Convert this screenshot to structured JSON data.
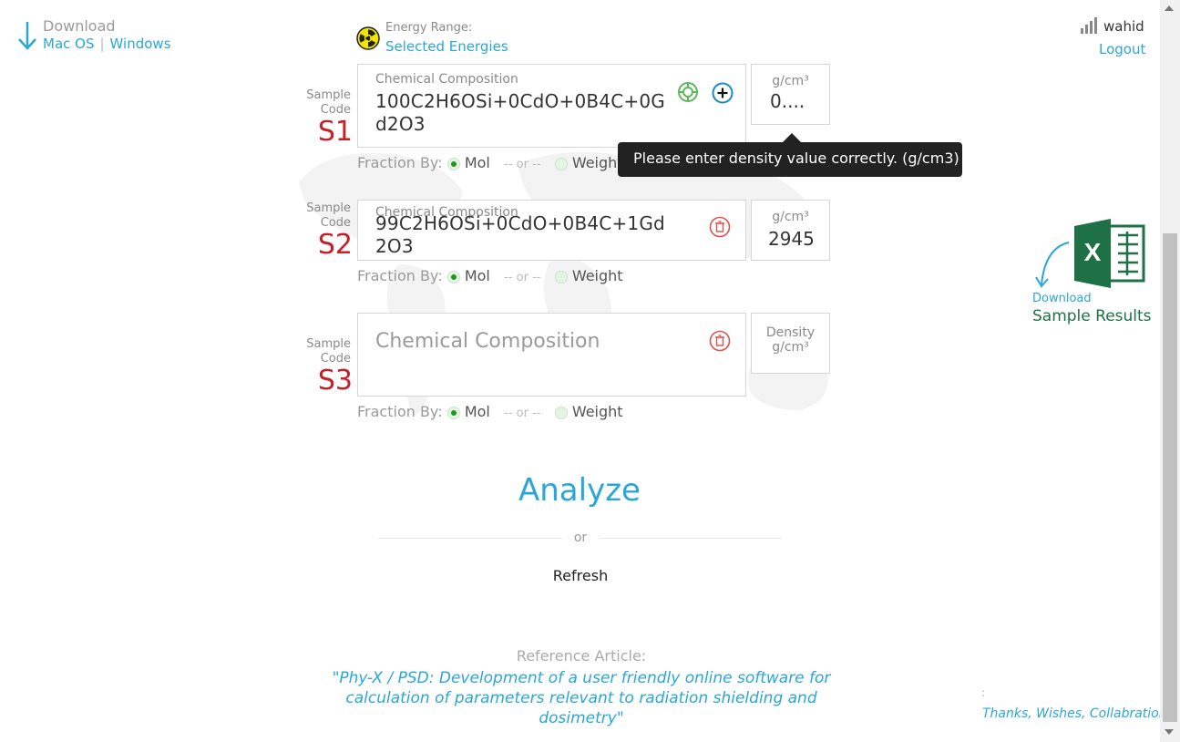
{
  "download": {
    "title": "Download",
    "mac_label": "Mac OS",
    "separator": "|",
    "windows_label": "Windows"
  },
  "energy": {
    "label": "Energy Range:",
    "value": "Selected Energies",
    "icon": "radiation-icon"
  },
  "user": {
    "name": "wahid",
    "logout": "Logout"
  },
  "samples": [
    {
      "label_line1": "Sample",
      "label_line2": "Code",
      "code": "S1",
      "comp_label": "Chemical Composition",
      "comp_value": "100C2H6OSi+0CdO+0B4C+0Gd2O3",
      "density_unit": "g/cm³",
      "density_value": "0....",
      "fraction_label": "Fraction By:",
      "mol": "Mol",
      "or": "-- or --",
      "weight": "Weight",
      "selected": "Mol"
    },
    {
      "label_line1": "Sample",
      "label_line2": "Code",
      "code": "S2",
      "comp_label": "Chemical Composition",
      "comp_value": "99C2H6OSi+0CdO+0B4C+1Gd2O3",
      "density_unit": "g/cm³",
      "density_value": "2945",
      "fraction_label": "Fraction By:",
      "mol": "Mol",
      "or": "-- or --",
      "weight": "Weight",
      "selected": "Mol"
    },
    {
      "label_line1": "Sample",
      "label_line2": "Code",
      "code": "S3",
      "comp_placeholder": "Chemical Composition",
      "density_placeholder_1": "Density",
      "density_placeholder_2": "g/cm³",
      "fraction_label": "Fraction By:",
      "mol": "Mol",
      "or": "-- or --",
      "weight": "Weight",
      "selected": "Mol"
    }
  ],
  "tooltip": "Please enter density value correctly. (g/cm3)",
  "analyze": "Analyze",
  "or": "or",
  "refresh": "Refresh",
  "reference": {
    "label": "Reference Article:",
    "line1": "\"Phy-X / PSD: Development of a user friendly online software for",
    "line2": "calculation of parameters relevant to radiation shielding and dosimetry\""
  },
  "excel": {
    "download": "Download",
    "sample_results": "Sample Results"
  },
  "footer": {
    "colon": ":",
    "thanks": "Thanks, Wishes, Collabration"
  },
  "colors": {
    "accent": "#2aa7d8",
    "code_red": "#c81e28",
    "excel_green": "#1e7145"
  }
}
